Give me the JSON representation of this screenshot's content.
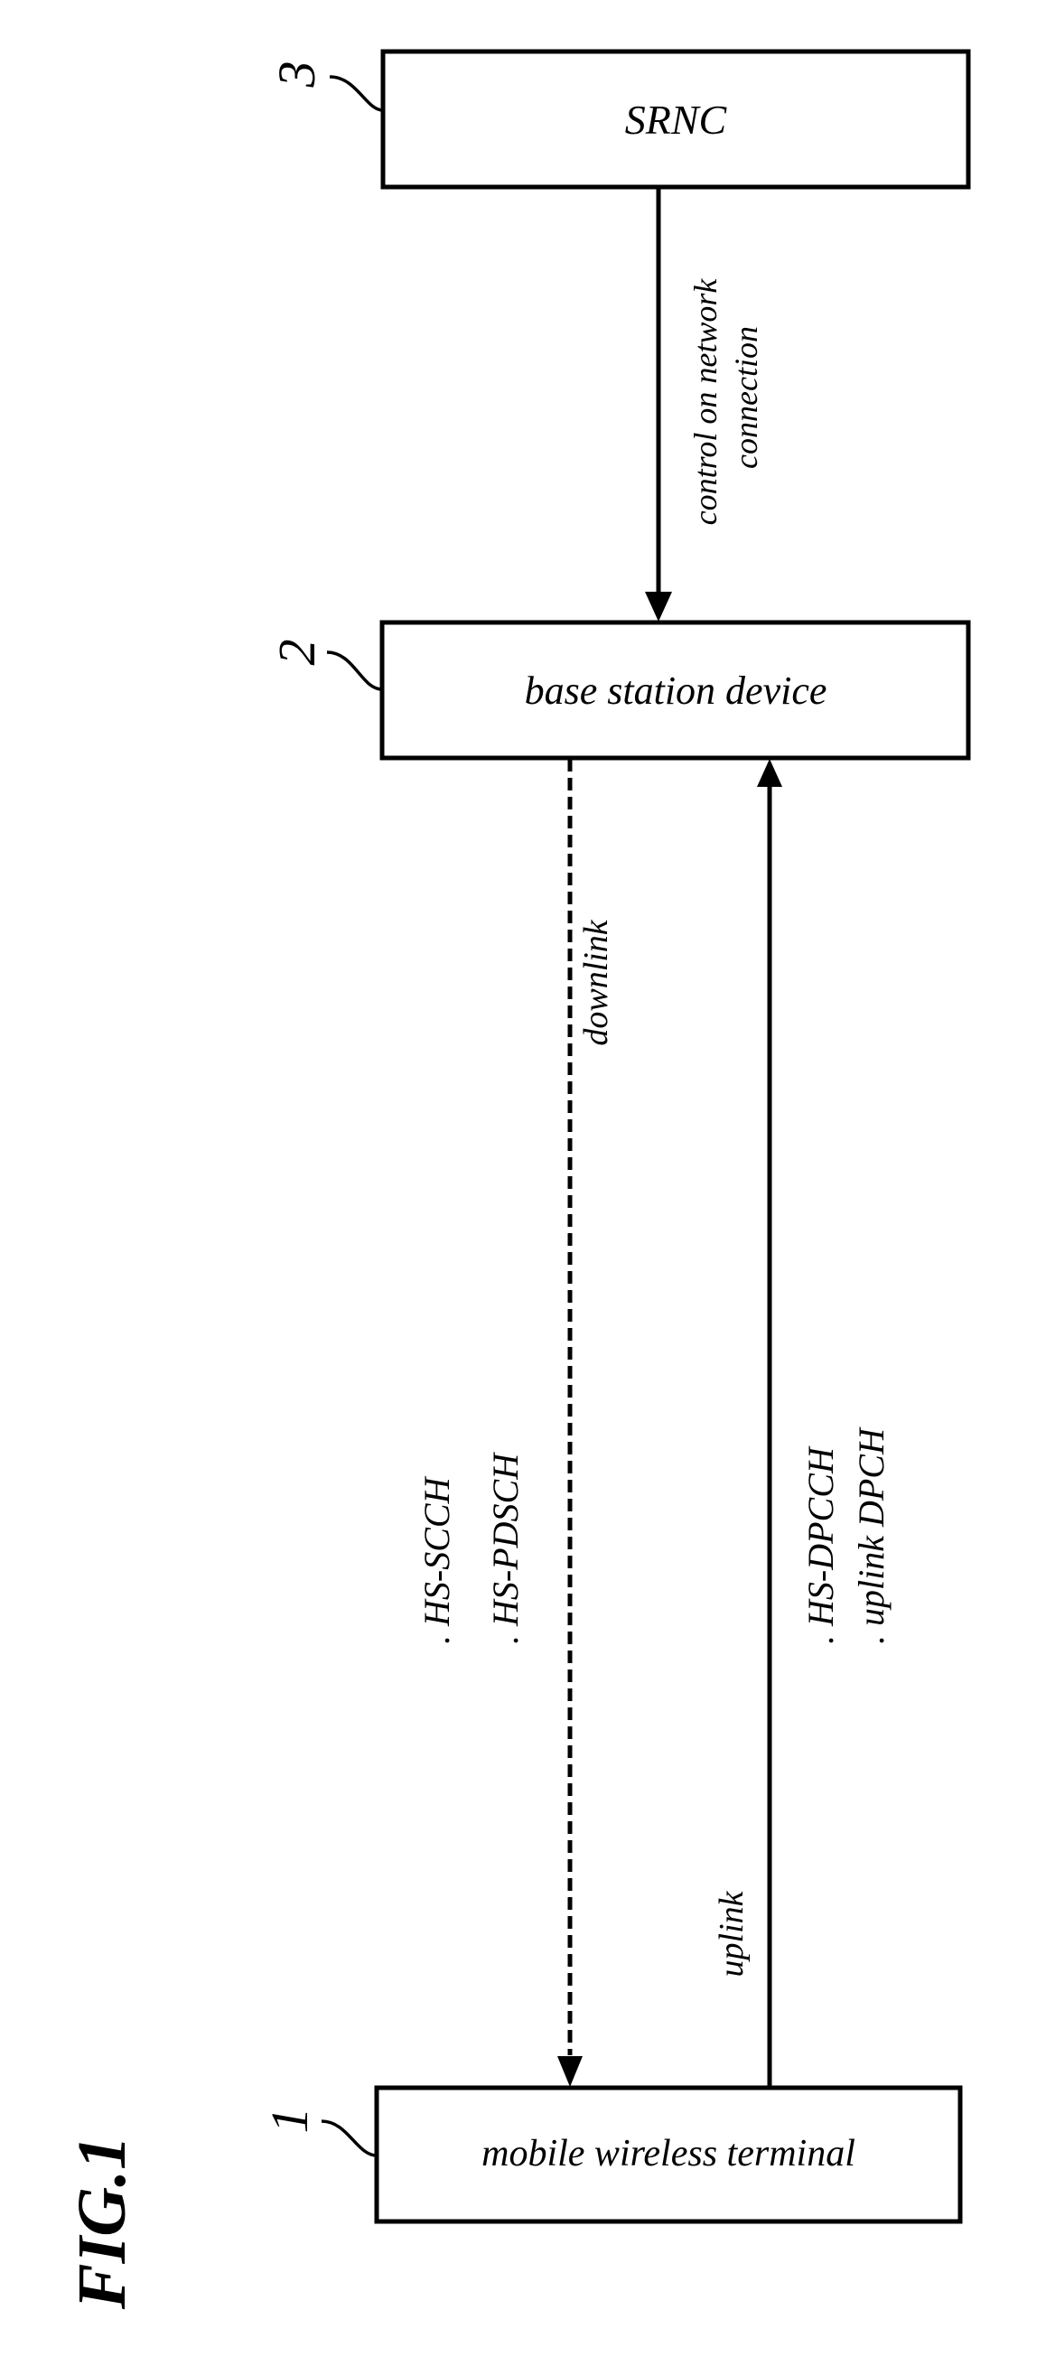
{
  "figure": {
    "label": "FIG.1"
  },
  "nodes": [
    {
      "id": "srnc",
      "ref": "3",
      "label": "SRNC"
    },
    {
      "id": "base-station",
      "ref": "2",
      "label": "base station device"
    },
    {
      "id": "mobile-terminal",
      "ref": "1",
      "label": "mobile wireless terminal"
    }
  ],
  "links": {
    "control": {
      "from": "SRNC",
      "to": "base station device",
      "style": "solid",
      "label_line1": "control on network",
      "label_line2": "connection"
    },
    "downlink": {
      "from": "base station device",
      "to": "mobile wireless terminal",
      "style": "dashed",
      "label": "downlink",
      "channels": [
        ". HS-SCCH",
        ". HS-PDSCH"
      ]
    },
    "uplink": {
      "from": "mobile wireless terminal",
      "to": "base station device",
      "style": "solid",
      "label": "uplink",
      "channels": [
        ". HS-DPCCH",
        ". uplink DPCH"
      ]
    }
  }
}
